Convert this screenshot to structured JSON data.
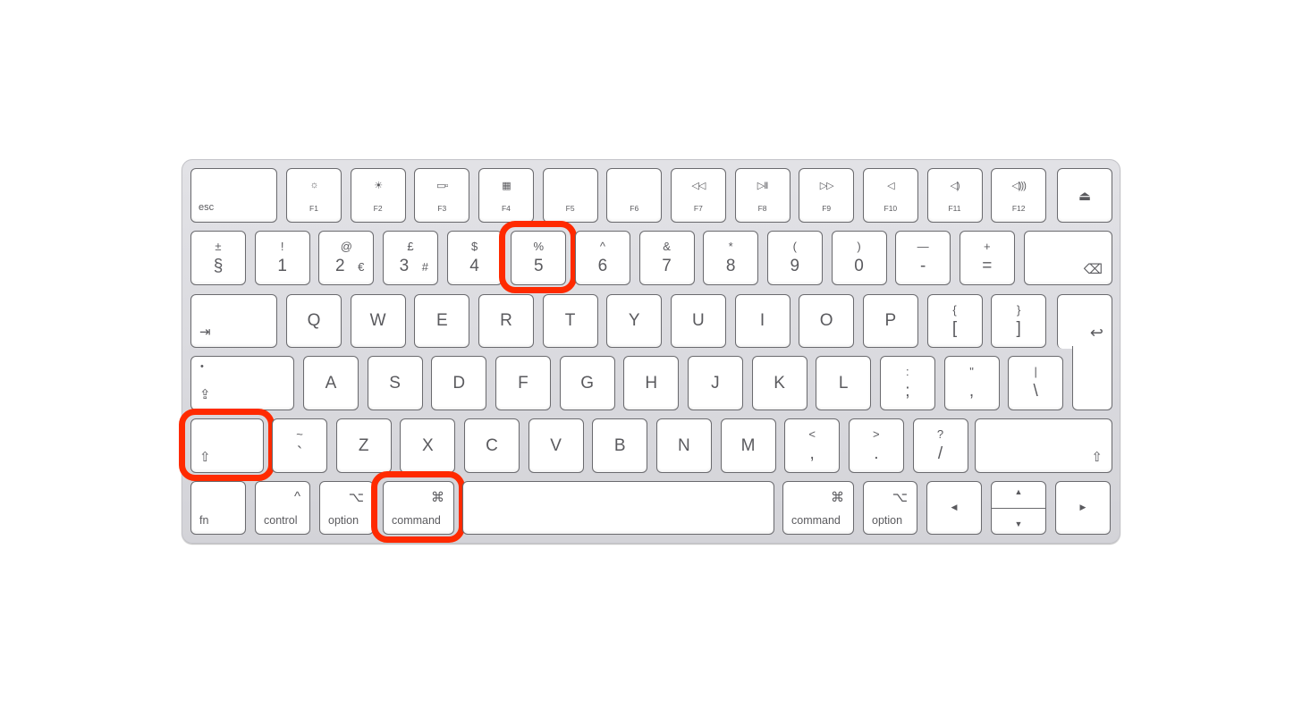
{
  "accent_color": "#ff2a00",
  "keyboard": {
    "rows": [
      [
        {
          "caption": "esc"
        },
        {
          "icon": "☼",
          "caption": "F1"
        },
        {
          "icon": "☀",
          "caption": "F2"
        },
        {
          "icon": "▭▫",
          "caption": "F3"
        },
        {
          "icon": "▦",
          "caption": "F4"
        },
        {
          "caption": "F5"
        },
        {
          "caption": "F6"
        },
        {
          "icon": "◁◁",
          "caption": "F7"
        },
        {
          "icon": "▷II",
          "caption": "F8"
        },
        {
          "icon": "▷▷",
          "caption": "F9"
        },
        {
          "icon": "◁",
          "caption": "F10"
        },
        {
          "icon": "◁)",
          "caption": "F11"
        },
        {
          "icon": "◁)))",
          "caption": "F12"
        },
        {
          "icon": "⏏",
          "name": "eject"
        }
      ],
      [
        {
          "main": "§",
          "shift": "±"
        },
        {
          "main": "1",
          "shift": "!"
        },
        {
          "main": "2",
          "shift": "@",
          "alt": "€"
        },
        {
          "main": "3",
          "shift": "£",
          "alt": "#"
        },
        {
          "main": "4",
          "shift": "$"
        },
        {
          "main": "5",
          "shift": "%",
          "highlighted": true
        },
        {
          "main": "6",
          "shift": "^"
        },
        {
          "main": "7",
          "shift": "&"
        },
        {
          "main": "8",
          "shift": "*"
        },
        {
          "main": "9",
          "shift": "("
        },
        {
          "main": "0",
          "shift": ")"
        },
        {
          "main": "-",
          "shift": "—"
        },
        {
          "main": "=",
          "shift": "+"
        },
        {
          "icon": "⌫",
          "name": "delete"
        }
      ],
      [
        {
          "icon": "⇥",
          "name": "tab"
        },
        {
          "main": "Q"
        },
        {
          "main": "W"
        },
        {
          "main": "E"
        },
        {
          "main": "R"
        },
        {
          "main": "T"
        },
        {
          "main": "Y"
        },
        {
          "main": "U"
        },
        {
          "main": "I"
        },
        {
          "main": "O"
        },
        {
          "main": "P"
        },
        {
          "main": "[",
          "shift": "{"
        },
        {
          "main": "]",
          "shift": "}"
        },
        {
          "icon": "↩",
          "name": "return"
        }
      ],
      [
        {
          "icon": "⇪",
          "dot": "•",
          "name": "caps-lock"
        },
        {
          "main": "A"
        },
        {
          "main": "S"
        },
        {
          "main": "D"
        },
        {
          "main": "F"
        },
        {
          "main": "G"
        },
        {
          "main": "H"
        },
        {
          "main": "J"
        },
        {
          "main": "K"
        },
        {
          "main": "L"
        },
        {
          "main": ";",
          "shift": ":"
        },
        {
          "main": ",",
          "shift": "\""
        },
        {
          "main": "\\",
          "shift": "|"
        }
      ],
      [
        {
          "icon": "⇧",
          "name": "left-shift",
          "highlighted": true
        },
        {
          "main": "`",
          "shift": "~"
        },
        {
          "main": "Z"
        },
        {
          "main": "X"
        },
        {
          "main": "C"
        },
        {
          "main": "V"
        },
        {
          "main": "B"
        },
        {
          "main": "N"
        },
        {
          "main": "M"
        },
        {
          "main": ",",
          "shift": "<"
        },
        {
          "main": ".",
          "shift": ">"
        },
        {
          "main": "/",
          "shift": "?"
        },
        {
          "icon": "⇧",
          "name": "right-shift"
        }
      ],
      [
        {
          "caption": "fn"
        },
        {
          "icon": "^",
          "caption": "control"
        },
        {
          "icon": "⌥",
          "caption": "option"
        },
        {
          "icon": "⌘",
          "caption": "command",
          "highlighted": true
        },
        {
          "name": "space"
        },
        {
          "icon": "⌘",
          "caption": "command",
          "name": "right-command"
        },
        {
          "icon": "⌥",
          "caption": "option",
          "name": "right-option"
        },
        {
          "icon": "◀",
          "name": "arrow-left"
        },
        {
          "icon_up": "▲",
          "icon_down": "▼",
          "name": "arrow-up-down"
        },
        {
          "icon": "▶",
          "name": "arrow-right"
        }
      ]
    ]
  }
}
